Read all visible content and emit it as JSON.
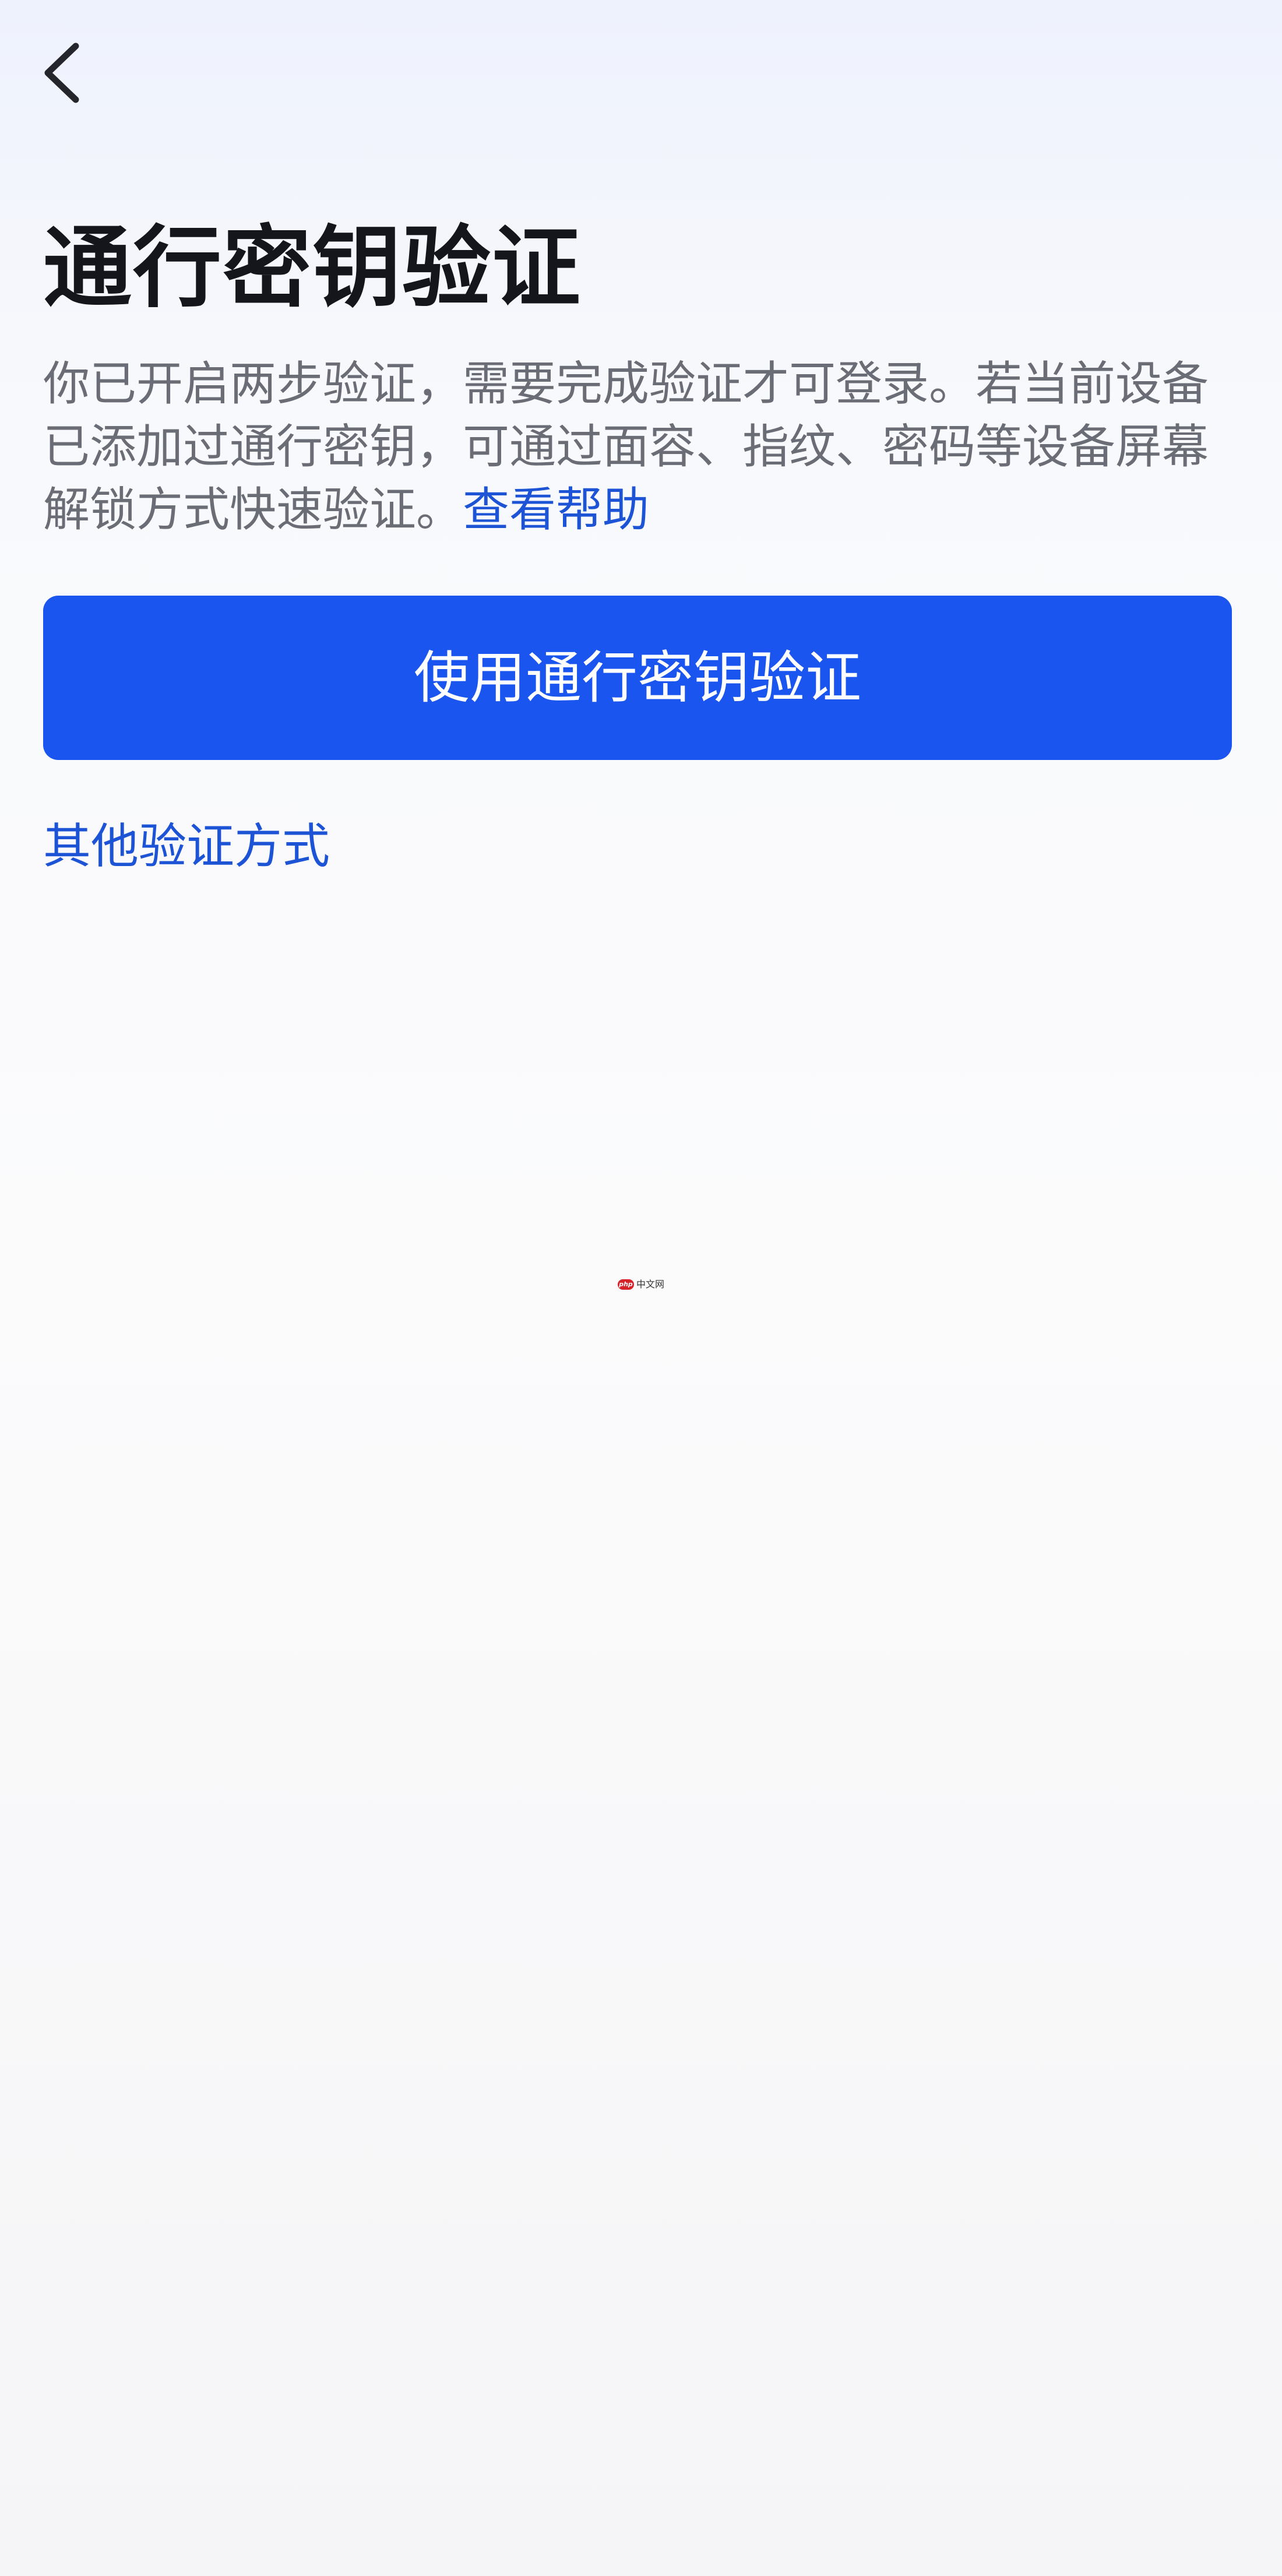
{
  "header": {
    "back_icon": "chevron-left-icon"
  },
  "main": {
    "title": "通行密钥验证",
    "description": "你已开启两步验证，需要完成验证才可登录。若当前设备已添加过通行密钥，可通过面容、指纹、密码等设备屏幕解锁方式快速验证。",
    "help_link": "查看帮助",
    "primary_button": "使用通行密钥验证",
    "other_methods_link": "其他验证方式"
  },
  "watermark": {
    "logo": "php",
    "text": "中文网"
  },
  "colors": {
    "primary": "#1a55ef",
    "link": "#1d54d6",
    "title_text": "#14161c",
    "body_text": "#6a6d75"
  }
}
